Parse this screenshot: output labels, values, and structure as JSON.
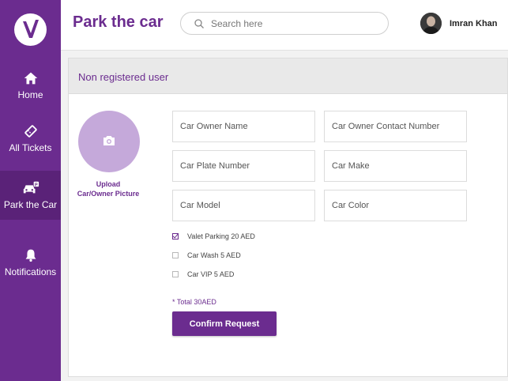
{
  "sidebar": {
    "items": [
      {
        "label": "Home",
        "icon": "home-icon",
        "active": false
      },
      {
        "label": "All Tickets",
        "icon": "ticket-icon",
        "active": false
      },
      {
        "label": "Park the Car",
        "icon": "car-icon",
        "active": true
      },
      {
        "label": "Notifications",
        "icon": "bell-icon",
        "active": false
      }
    ]
  },
  "header": {
    "title": "Park the car",
    "search_placeholder": "Search here",
    "user_name": "Imran Khan"
  },
  "form": {
    "section_title": "Non registered user",
    "upload_label_line1": "Upload",
    "upload_label_line2": "Car/Owner Picture",
    "fields": {
      "owner_name": "Car Owner Name",
      "owner_contact": "Car Owner Contact Number",
      "plate_number": "Car Plate Number",
      "make": "Car Make",
      "model": "Car Model",
      "color": "Car Color"
    },
    "options": [
      {
        "label": "Valet Parking 20 AED",
        "checked": true
      },
      {
        "label": "Car Wash 5 AED",
        "checked": false
      },
      {
        "label": "Car VIP 5 AED",
        "checked": false
      }
    ],
    "total": "* Total 30AED",
    "confirm_label": "Confirm Request"
  },
  "colors": {
    "brand": "#6b2c8f",
    "brand_dark": "#5a2278",
    "upload_circle": "#c5a9da"
  }
}
